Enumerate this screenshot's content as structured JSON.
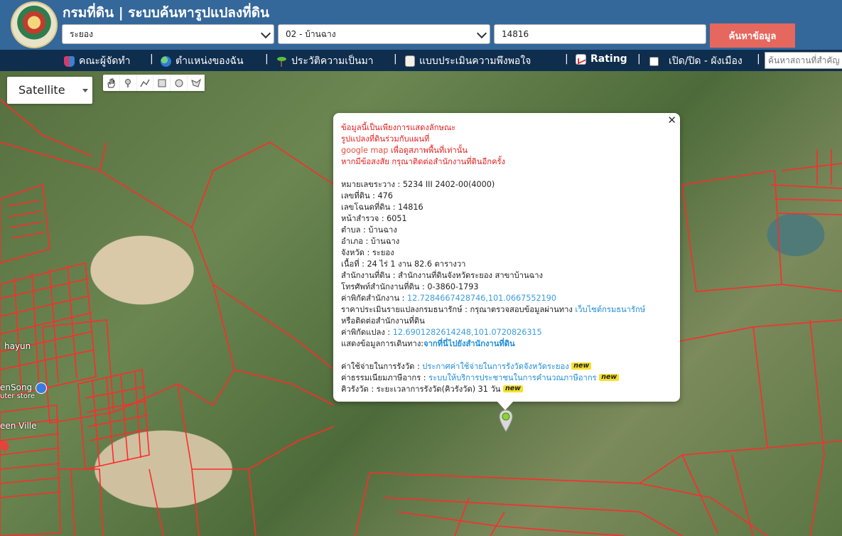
{
  "header": {
    "title": "กรมที่ดิน | ระบบค้นหารูปแปลงที่ดิน",
    "province": "ระยอง",
    "district": "02 - บ้านฉาง",
    "parcel_no": "14816",
    "search_label": "ค้นหาข้อมูล"
  },
  "nav": {
    "items": [
      "คณะผู้จัดทำ",
      "ตำแหน่งของฉัน",
      "ประวัติความเป็นมา",
      "แบบประเมินความพึงพอใจ",
      "Rating",
      "เปิด/ปิด - ผังเมือง"
    ],
    "place_search_placeholder": "ค้นหาสถานที่สำคัญ"
  },
  "map": {
    "maptype": "Satellite",
    "labels": [
      "hayun",
      "enSong",
      "uter store",
      "een Ville"
    ]
  },
  "info": {
    "disclaimer": [
      "ข้อมูลนี้เป็นเพียงการแสดงลักษณะ",
      "รูปแปลงที่ดินร่วมกับแผนที่",
      "google map",
      "เพื่อดูสภาพพื้นที่เท่านั้น",
      "หากมีข้อสงสัย กรุณาติดต่อสำนักงานที่ดินอีกครั้ง"
    ],
    "sheet": "หมายเลขระวาง : 5234 III 2402-00(4000)",
    "land_no": "เลขที่ดิน : 476",
    "deed_no": "เลขโฉนดที่ดิน : 14816",
    "survey_page": "หน้าสำรวจ : 6051",
    "subdistrict": "ตำบล : บ้านฉาง",
    "amphoe": "อำเภอ : บ้านฉาง",
    "province": "จังหวัด : ระยอง",
    "area": "เนื้อที่ : 24 ไร่ 1 งาน 82.6 ตารางวา",
    "office": "สำนักงานที่ดิน : สำนักงานที่ดินจังหวัดระยอง สาขาบ้านฉาง",
    "phone": "โทรศัพท์สำนักงานที่ดิน : 0-3860-1793",
    "office_coord_label": "ค่าพิกัดสำนักงาน :",
    "office_coord": "12.7284667428746,101.0667552190",
    "appraisal_label": "ราคาประเมินรายแปลงกรมธนารักษ์ : กรุณาตรวจสอบข้อมูลผ่านทาง",
    "appraisal_link": "เว็บไซต์กรมธนารักษ์",
    "appraisal_suffix": "หรือติดต่อสำนักงานที่ดิน",
    "parcel_coord_label": "ค่าพิกัดแปลง :",
    "parcel_coord": "12.6901282614248,101.0720826315",
    "route_label": "แสดงข้อมูลการเดินทาง:",
    "route_link": "จากที่นี่ไปยังสำนักงานที่ดิน",
    "fee_label": "ค่าใช้จ่ายในการรังวัด :",
    "fee_link": "ประกาศค่าใช้จ่ายในการรังวัดจังหวัดระยอง",
    "tax_label": "ค่าธรรมเนียมภาษีอากร :",
    "tax_link": "ระบบให้บริการประชาชนในการคำนวณภาษีอากร",
    "queue_label": "คิวรังวัด : ระยะเวลาการรังวัด(คิวรังวัด) 31 วัน",
    "new_badge": "new"
  }
}
